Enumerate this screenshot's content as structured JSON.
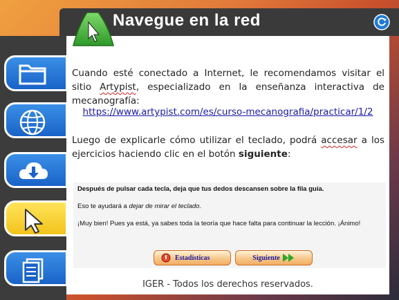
{
  "header": {
    "title": "Navegue en la red"
  },
  "intro": {
    "p1_a": "Cuando esté conectado a Internet, le recomendamos visitar el sitio ",
    "p1_brand": "Artypist",
    "p1_b": ", especializado en la enseñanza interactiva de mecanografía:",
    "link": "https://www.artypist.com/es/curso-mecanografia/practicar/1/2",
    "p2_a": "Luego de explicarle cómo utilizar el teclado, podrá ",
    "p2_word": "accesar",
    "p2_b": " a los ejercicios haciendo clic en el botón ",
    "p2_bold": "siguiente",
    "p2_c": ":"
  },
  "lesson": {
    "line1": "Después de pulsar cada tecla, deja que tus dedos descansen sobre la fila guía.",
    "line2_a": "Eso te ayudará a ",
    "line2_em": "dejar de mirar el teclado",
    "line2_b": ".",
    "line3": "¡Muy bien! Pues ya está, ya sabes toda la teoría que hace falta para continuar la lección. ¡Ánimo!",
    "stats_label": "Estadísticas",
    "next_label": "Siguiente"
  },
  "footer": "IGER - Todos los derechos reservados.",
  "sidebar": {
    "items": [
      {
        "icon": "folder-icon"
      },
      {
        "icon": "globe-icon"
      },
      {
        "icon": "cloud-download-icon"
      },
      {
        "icon": "cursor-icon",
        "active": true
      },
      {
        "icon": "documents-icon"
      }
    ]
  },
  "colors": {
    "accent_blue": "#1a63c8",
    "accent_yellow": "#f2c31c",
    "link": "#1a1aa8",
    "header_dark": "#3a3a3a"
  }
}
